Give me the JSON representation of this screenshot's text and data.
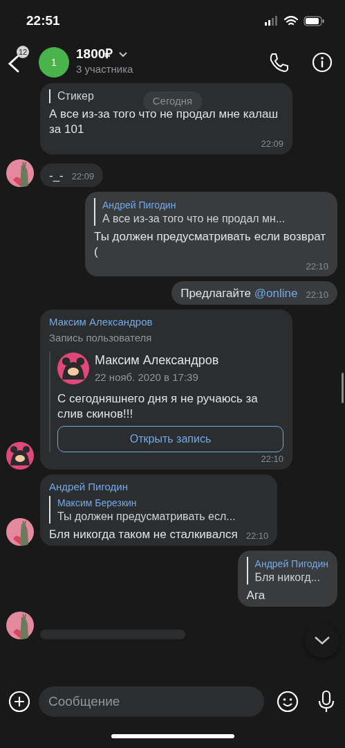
{
  "status_bar": {
    "time": "22:51"
  },
  "header": {
    "back_badge": "12",
    "avatar_letter": "1",
    "title": "1800₽",
    "subtitle": "3 участника"
  },
  "date_pill": "Сегодня",
  "messages": [
    {
      "kind": "text",
      "outgoing": false,
      "avatar": false,
      "reply": {
        "text": "Стикер"
      },
      "text": "А все из-за того что не продал мне калаш за 101",
      "time": "22:09"
    },
    {
      "kind": "text",
      "outgoing": false,
      "avatar": true,
      "text": "-_-",
      "time": "22:09"
    },
    {
      "kind": "text",
      "outgoing": true,
      "reply": {
        "author": "Андрей Пигодин",
        "text": "А все из-за того что не продал мн..."
      },
      "text": "Ты должен предусматривать если возврат (",
      "time": "22:10"
    },
    {
      "kind": "text",
      "outgoing": true,
      "text": "Предлагайте",
      "mention": "@online",
      "time": "22:10"
    },
    {
      "kind": "post",
      "outgoing": false,
      "avatar": true,
      "sender": "Максим Александров",
      "subtitle": "Запись пользователя",
      "post": {
        "author": "Максим Александров",
        "date": "22 нояб. 2020 в 17:39",
        "text": "С сегодняшнего дня я не ручаюсь за слив скинов!!!",
        "button": "Открыть запись"
      },
      "time": "22:10"
    },
    {
      "kind": "text",
      "outgoing": false,
      "avatar": true,
      "sender": "Андрей Пигодин",
      "reply": {
        "author": "Максим Березкин",
        "text": "Ты должен предусматривать есл..."
      },
      "text": "Бля никогда таком не сталкивался",
      "time": "22:10"
    },
    {
      "kind": "text",
      "outgoing": true,
      "reply": {
        "author": "Андрей Пигодин",
        "text": "Бля никогд..."
      },
      "text": "Ага"
    },
    {
      "kind": "partial",
      "outgoing": false,
      "avatar": true
    }
  ],
  "composer": {
    "placeholder": "Сообщение"
  }
}
